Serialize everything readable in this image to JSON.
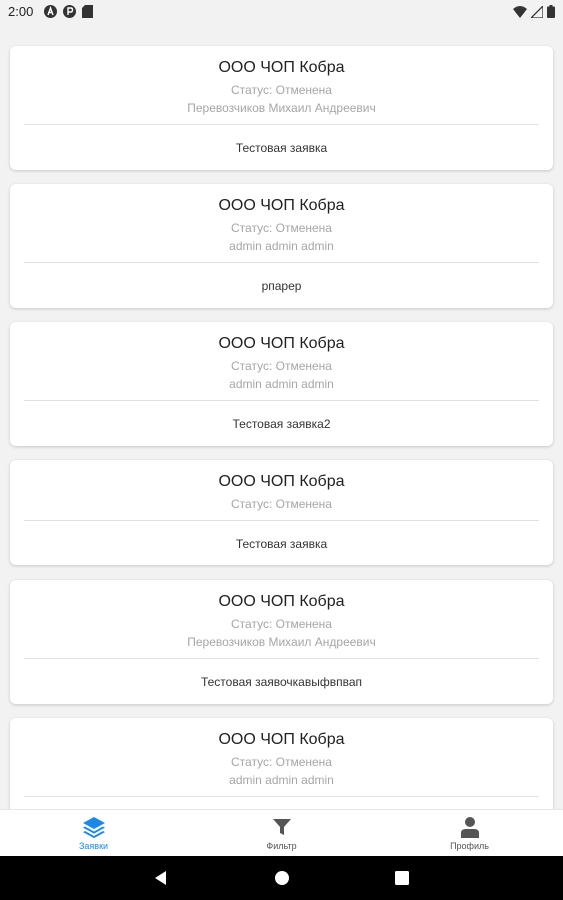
{
  "status_bar": {
    "time": "2:00"
  },
  "cards": [
    {
      "title": "ООО ЧОП Кобра",
      "status": "Статус: Отменена",
      "person": "Перевозчиков Михаил Андреевич",
      "description": "Тестовая заявка"
    },
    {
      "title": "ООО ЧОП Кобра",
      "status": "Статус: Отменена",
      "person": "admin admin admin",
      "description": "рпарер"
    },
    {
      "title": "ООО ЧОП Кобра",
      "status": "Статус: Отменена",
      "person": "admin admin admin",
      "description": "Тестовая заявка2"
    },
    {
      "title": "ООО ЧОП Кобра",
      "status": "Статус: Отменена",
      "person": "",
      "description": "Тестовая заявка"
    },
    {
      "title": "ООО ЧОП Кобра",
      "status": "Статус: Отменена",
      "person": "Перевозчиков Михаил Андреевич",
      "description": "Тестовая заявочкавыфвпвап"
    },
    {
      "title": "ООО ЧОП Кобра",
      "status": "Статус: Отменена",
      "person": "admin admin admin",
      "description": ""
    }
  ],
  "bottom_nav": {
    "items": [
      {
        "label": "Заявки",
        "icon": "layers-icon",
        "active": true
      },
      {
        "label": "Фильтр",
        "icon": "filter-icon",
        "active": false
      },
      {
        "label": "Профиль",
        "icon": "person-icon",
        "active": false
      }
    ],
    "active_color": "#1e88e5",
    "inactive_color": "#555555"
  }
}
